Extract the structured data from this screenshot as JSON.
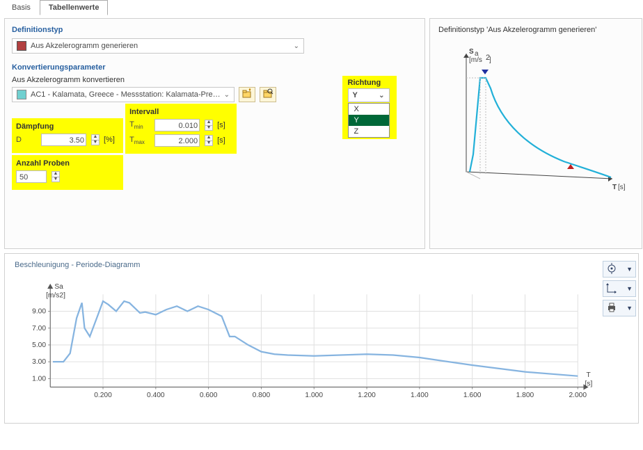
{
  "tabs": {
    "basis": "Basis",
    "tabellen": "Tabellenwerte"
  },
  "deftype": {
    "title": "Definitionstyp",
    "value": "Aus Akzelerogramm generieren"
  },
  "convparam": {
    "title": "Konvertierungsparameter",
    "from": "Aus Akzelerogramm konvertieren",
    "accel_value": "AC1 - Kalamata, Greece - Messstation: Kalamata-Pre…"
  },
  "richtung": {
    "label": "Richtung",
    "selected": "Y",
    "options": [
      "X",
      "Y",
      "Z"
    ]
  },
  "damping": {
    "title": "Dämpfung",
    "D": "D",
    "value": "3.50",
    "unit": "[%]"
  },
  "interval": {
    "title": "Intervall",
    "tmin": "Tmin",
    "tmin_val": "0.010",
    "tmax": "Tmax",
    "tmax_val": "2.000",
    "unit": "[s]"
  },
  "samples": {
    "title": "Anzahl Proben",
    "value": "50"
  },
  "preview": {
    "title": "Definitionstyp 'Aus Akzelerogramm generieren'",
    "y_label": "Sa",
    "y_unit": "[m/s2]",
    "x_label": "T",
    "x_unit": "[s]"
  },
  "chart": {
    "title": "Beschleunigung - Periode-Diagramm",
    "y_label": "Sa",
    "y_unit": "[m/s2]",
    "x_label": "T",
    "x_unit": "[s]",
    "y_ticks": [
      "1.00",
      "3.00",
      "5.00",
      "7.00",
      "9.00"
    ],
    "x_ticks": [
      "0.200",
      "0.400",
      "0.600",
      "0.800",
      "1.000",
      "1.200",
      "1.400",
      "1.600",
      "1.800",
      "2.000"
    ]
  },
  "chart_data": {
    "type": "line",
    "title": "Beschleunigung - Periode-Diagramm",
    "xlabel": "T [s]",
    "ylabel": "Sa [m/s2]",
    "ylim": [
      0,
      11
    ],
    "xlim": [
      0,
      2.0
    ],
    "x": [
      0.01,
      0.05,
      0.075,
      0.1,
      0.12,
      0.13,
      0.15,
      0.18,
      0.2,
      0.22,
      0.25,
      0.28,
      0.3,
      0.34,
      0.36,
      0.4,
      0.44,
      0.48,
      0.52,
      0.56,
      0.6,
      0.65,
      0.68,
      0.7,
      0.75,
      0.8,
      0.85,
      0.9,
      1.0,
      1.1,
      1.2,
      1.3,
      1.4,
      1.6,
      1.8,
      2.0
    ],
    "values": [
      3.0,
      3.0,
      4.0,
      8.2,
      10.0,
      7.0,
      6.0,
      8.5,
      10.2,
      9.8,
      9.0,
      10.2,
      10.0,
      8.8,
      8.9,
      8.6,
      9.2,
      9.6,
      9.0,
      9.6,
      9.2,
      8.4,
      6.0,
      6.0,
      5.0,
      4.2,
      3.9,
      3.8,
      3.7,
      3.8,
      3.9,
      3.8,
      3.5,
      2.6,
      1.8,
      1.3
    ]
  }
}
